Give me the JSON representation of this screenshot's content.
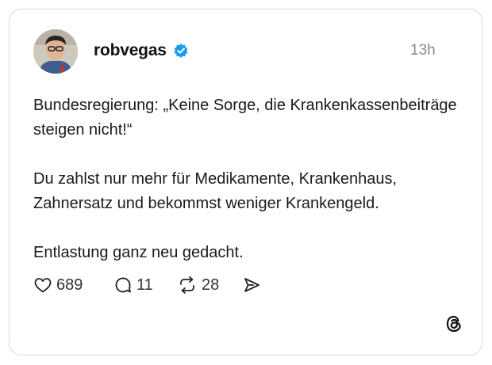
{
  "post": {
    "username": "robvegas",
    "verified_icon": "verified-badge-icon",
    "time": "13h",
    "paragraphs": [
      "Bundesregierung: „Keine Sorge, die Krankenkassenbeiträge steigen nicht!“",
      "Du zahlst nur mehr für Medikamente, Krankenhaus, Zahnersatz und bekommst weniger Krankengeld.",
      "Entlastung ganz neu gedacht."
    ]
  },
  "actions": {
    "likes": "689",
    "replies": "11",
    "reposts": "28"
  },
  "icons": {
    "like": "heart-icon",
    "reply": "comment-icon",
    "repost": "repost-icon",
    "share": "send-icon",
    "brand": "threads-logo-icon"
  },
  "colors": {
    "verified": "#1d9bf0",
    "text": "#1a1a1a",
    "muted": "#8a8a8a"
  }
}
